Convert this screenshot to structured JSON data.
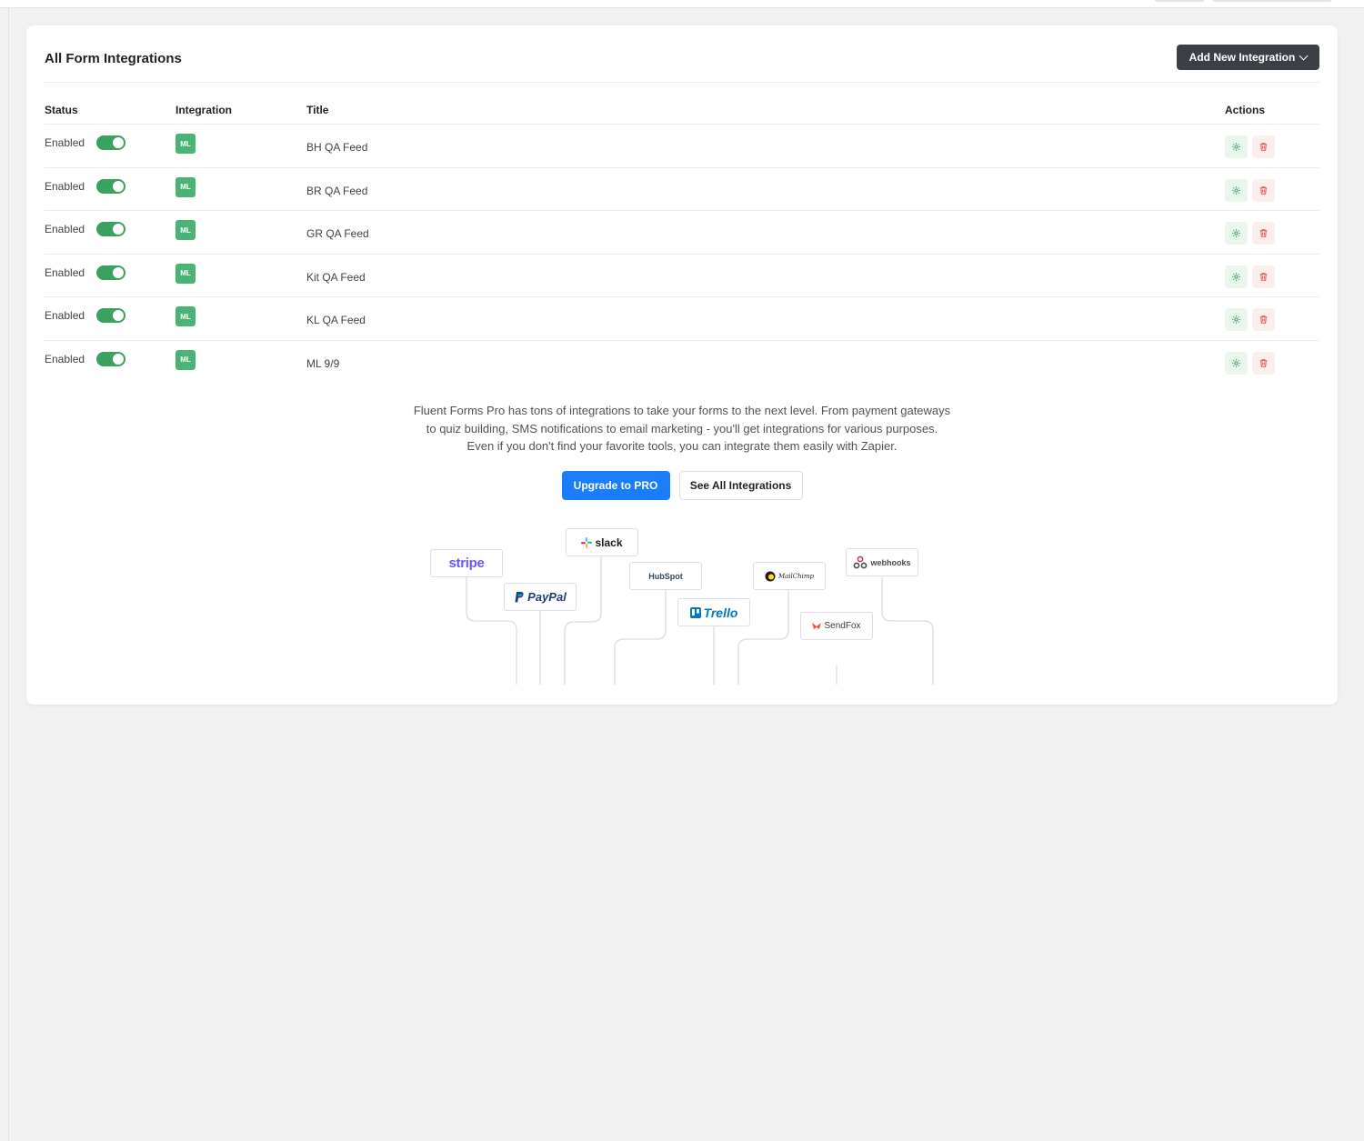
{
  "header": {
    "title": "All Form Integrations",
    "add_button_label": "Add New Integration"
  },
  "table": {
    "columns": {
      "status": "Status",
      "integration": "Integration",
      "title": "Title",
      "actions": "Actions"
    },
    "rows": [
      {
        "status": "Enabled",
        "enabled": true,
        "badge": "ML",
        "title": "BH QA Feed"
      },
      {
        "status": "Enabled",
        "enabled": true,
        "badge": "ML",
        "title": "BR QA Feed"
      },
      {
        "status": "Enabled",
        "enabled": true,
        "badge": "ML",
        "title": "GR QA Feed"
      },
      {
        "status": "Enabled",
        "enabled": true,
        "badge": "ML",
        "title": "Kit QA Feed"
      },
      {
        "status": "Enabled",
        "enabled": true,
        "badge": "ML",
        "title": "KL QA Feed"
      },
      {
        "status": "Enabled",
        "enabled": true,
        "badge": "ML",
        "title": "ML 9/9"
      }
    ]
  },
  "promo": {
    "line1": "Fluent Forms Pro has tons of integrations to take your forms to the next level. From payment gateways",
    "line2": "to quiz building, SMS notifications to email marketing - you'll get integrations for various purposes.",
    "line3": "Even if you don't find your favorite tools, you can integrate them easily with Zapier.",
    "upgrade_label": "Upgrade to PRO",
    "see_all_label": "See All Integrations"
  },
  "logos": {
    "stripe": "stripe",
    "paypal": "PayPal",
    "slack": "slack",
    "hubspot": "HubSpot",
    "trello": "Trello",
    "mailchimp": "MailChimp",
    "sendfox": "SendFox",
    "webhooks": "webhooks"
  },
  "colors": {
    "toggle_on": "#3aa25e",
    "badge": "#4ab474",
    "primary_button": "#1a7efb",
    "dark_button": "#3c3f45",
    "delete_red": "#e05555"
  }
}
